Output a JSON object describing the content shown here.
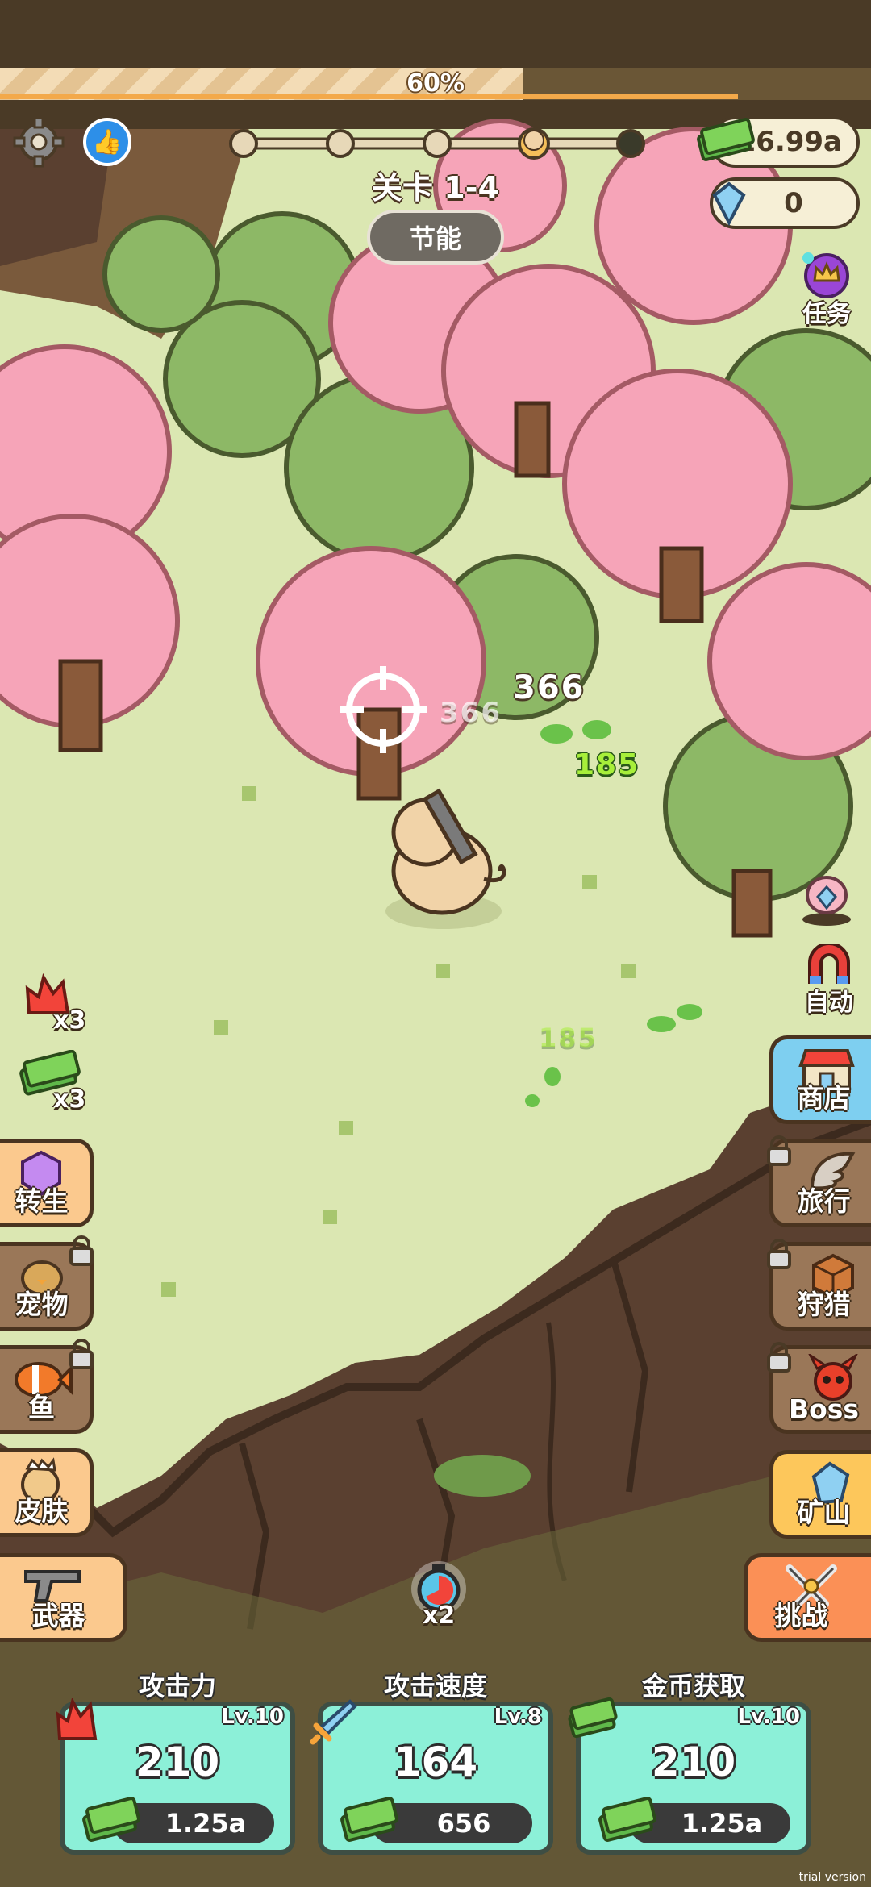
{
  "top": {
    "progress_text": "60%",
    "progress": 0.6
  },
  "level": {
    "label": "关卡 1-4",
    "stage_nodes": 5,
    "current_node": 4
  },
  "eco_button": "节能",
  "currency": {
    "cash": "16.99a",
    "gems": "0"
  },
  "task_label": "任务",
  "combat": {
    "hit1": "366",
    "hit2": "366",
    "cash1": "185",
    "cash2": "185"
  },
  "boosts": {
    "fire": "x3",
    "cash": "x3",
    "speed": "x2"
  },
  "left_menu": [
    {
      "label": "转生",
      "locked": false
    },
    {
      "label": "宠物",
      "locked": true
    },
    {
      "label": "鱼",
      "locked": true
    },
    {
      "label": "皮肤",
      "locked": false
    },
    {
      "label": "武器",
      "locked": false
    }
  ],
  "right_menu": [
    {
      "label": "自动",
      "locked": false
    },
    {
      "label": "商店",
      "locked": false
    },
    {
      "label": "旅行",
      "locked": true
    },
    {
      "label": "狩猎",
      "locked": true
    },
    {
      "label": "Boss",
      "locked": true
    },
    {
      "label": "矿山",
      "locked": false
    },
    {
      "label": "挑战",
      "locked": false
    }
  ],
  "upgrades": [
    {
      "title": "攻击力",
      "level": "Lv.10",
      "value": "210",
      "cost": "1.25a"
    },
    {
      "title": "攻击速度",
      "level": "Lv.8",
      "value": "164",
      "cost": "656"
    },
    {
      "title": "金币获取",
      "level": "Lv.10",
      "value": "210",
      "cost": "1.25a"
    }
  ],
  "watermark": "trial version"
}
